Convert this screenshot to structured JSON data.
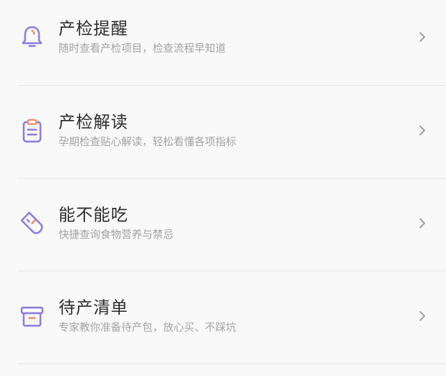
{
  "items": [
    {
      "title": "产检提醒",
      "subtitle": "随时查看产检项目，检查流程早知道",
      "icon": "bell-icon",
      "icon_color": "#8f7ae0",
      "accent_color": "#f08c6a"
    },
    {
      "title": "产检解读",
      "subtitle": "孕期检查贴心解读，轻松看懂各项指标",
      "icon": "clipboard-icon",
      "icon_color": "#8f7ae0",
      "accent_color": "#f08c6a"
    },
    {
      "title": "能不能吃",
      "subtitle": "快捷查询食物营养与禁忌",
      "icon": "food-tag-icon",
      "icon_color": "#8f7ae0",
      "accent_color": "#f08c6a"
    },
    {
      "title": "待产清单",
      "subtitle": "专家教你准备待产包，放心买、不踩坑",
      "icon": "archive-box-icon",
      "icon_color": "#8f7ae0",
      "accent_color": "#f08c6a"
    }
  ],
  "colors": {
    "background": "#f9f9f9",
    "title_text": "#2c2c2c",
    "subtitle_text": "#a3a3a3",
    "divider": "#e6e6e6",
    "chevron": "#9a9a9a"
  }
}
